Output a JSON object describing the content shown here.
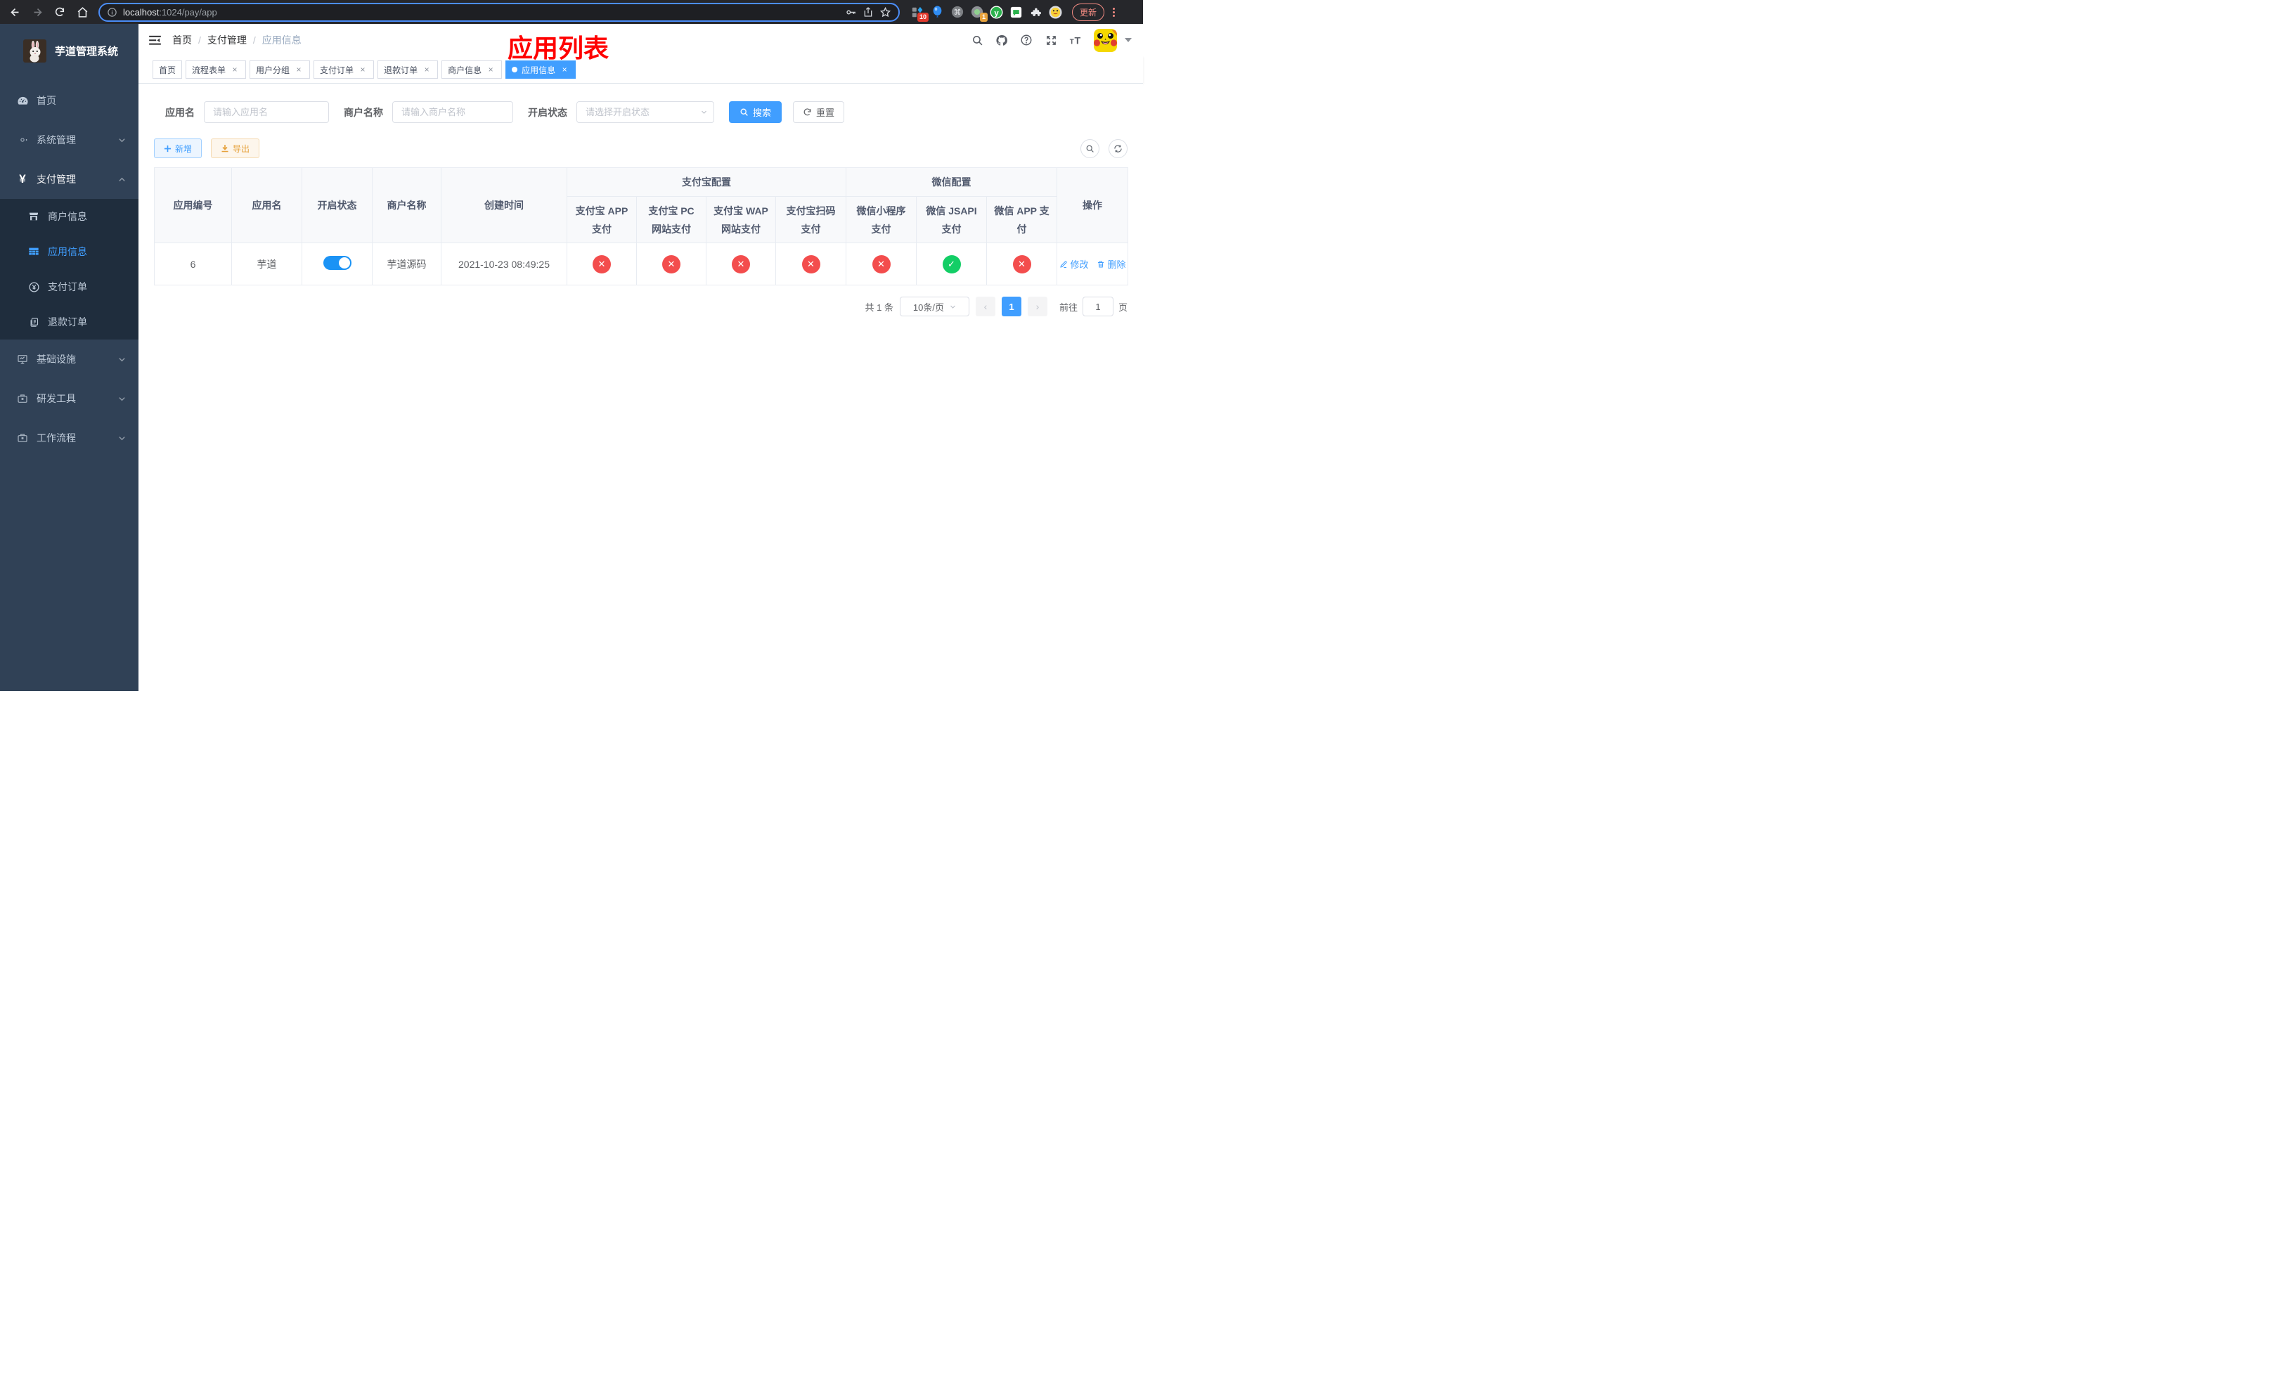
{
  "browser": {
    "url_host": "localhost",
    "url_rest": ":1024/pay/app",
    "ext_badge_blocker": "10",
    "ext_badge_proxy": "1",
    "ext_y_letter": "y",
    "update_label": "更新"
  },
  "sidebar": {
    "title": "芋道管理系统",
    "items": [
      {
        "label": "首页"
      },
      {
        "label": "系统管理"
      },
      {
        "label": "支付管理"
      },
      {
        "label": "基础设施"
      },
      {
        "label": "研发工具"
      },
      {
        "label": "工作流程"
      }
    ],
    "submenu": [
      {
        "label": "商户信息",
        "active": false
      },
      {
        "label": "应用信息",
        "active": true
      },
      {
        "label": "支付订单",
        "active": false
      },
      {
        "label": "退款订单",
        "active": false
      }
    ],
    "yen_glyph": "¥"
  },
  "breadcrumb": {
    "items": [
      "首页",
      "支付管理",
      "应用信息"
    ],
    "separator": "/"
  },
  "annotation": "应用列表",
  "tabs": {
    "close_glyph": "×",
    "items": [
      {
        "label": "首页",
        "closable": false,
        "active": false
      },
      {
        "label": "流程表单",
        "closable": true,
        "active": false
      },
      {
        "label": "用户分组",
        "closable": true,
        "active": false
      },
      {
        "label": "支付订单",
        "closable": true,
        "active": false
      },
      {
        "label": "退款订单",
        "closable": true,
        "active": false
      },
      {
        "label": "商户信息",
        "closable": true,
        "active": false
      },
      {
        "label": "应用信息",
        "closable": true,
        "active": true
      }
    ]
  },
  "filters": {
    "app_name_label": "应用名",
    "app_name_placeholder": "请输入应用名",
    "merchant_label": "商户名称",
    "merchant_placeholder": "请输入商户名称",
    "status_label": "开启状态",
    "status_placeholder": "请选择开启状态",
    "search_label": "搜索",
    "reset_label": "重置"
  },
  "toolbar": {
    "add_label": "新增",
    "export_label": "导出"
  },
  "table": {
    "pass_glyph": "✓",
    "fail_glyph": "✕",
    "columns": {
      "id": "应用编号",
      "name": "应用名",
      "enabled": "开启状态",
      "merchant": "商户名称",
      "created": "创建时间",
      "group_alipay": "支付宝配置",
      "group_wechat": "微信配置",
      "alipay_app": "支付宝 APP 支付",
      "alipay_pc": "支付宝 PC 网站支付",
      "alipay_wap": "支付宝 WAP 网站支付",
      "alipay_qr": "支付宝扫码支付",
      "wechat_lite": "微信小程序支付",
      "wechat_jsapi": "微信 JSAPI 支付",
      "wechat_app": "微信 APP 支付",
      "ops": "操作"
    },
    "row": {
      "id": "6",
      "name": "芋道",
      "enabled": true,
      "merchant": "芋道源码",
      "created": "2021-10-23 08:49:25",
      "configs": [
        "fail",
        "fail",
        "fail",
        "fail",
        "fail",
        "pass",
        "fail"
      ],
      "edit_label": "修改",
      "delete_label": "删除"
    }
  },
  "pagination": {
    "total_text": "共 1 条",
    "page_size": "10条/页",
    "prev_glyph": "‹",
    "next_glyph": "›",
    "current_page": "1",
    "goto_prefix": "前往",
    "goto_value": "1",
    "goto_suffix": "页"
  }
}
